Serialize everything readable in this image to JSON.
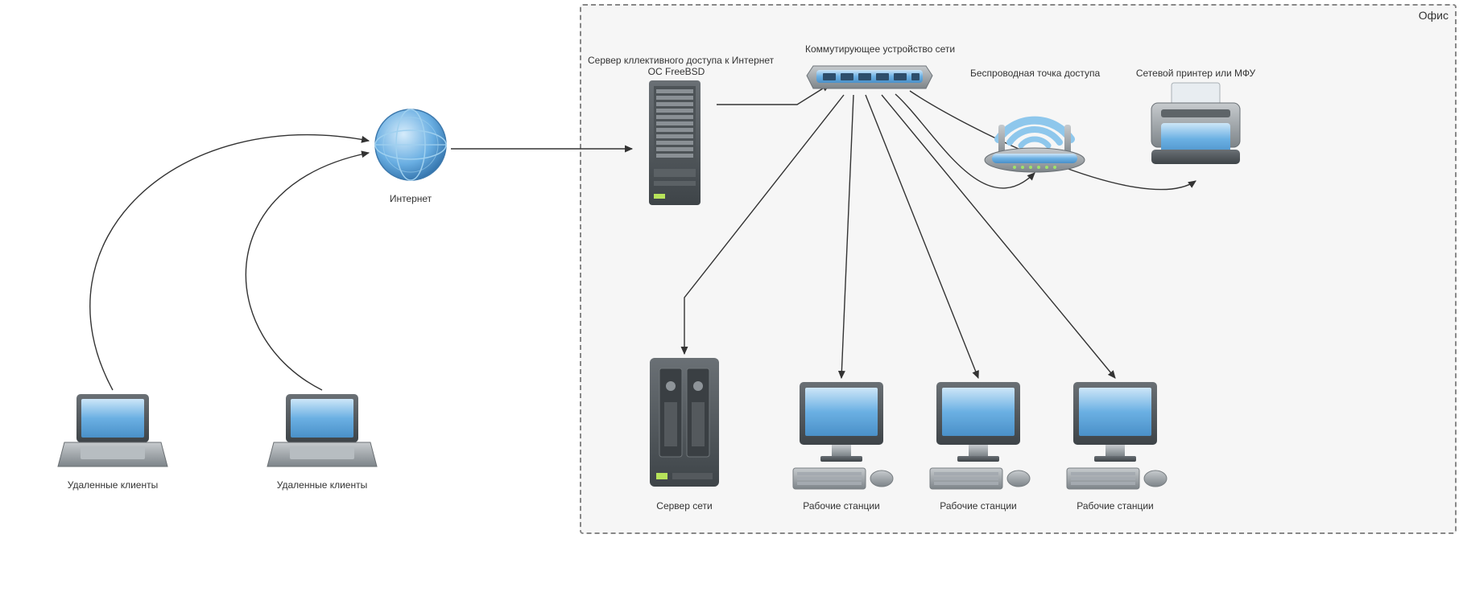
{
  "office": {
    "title": "Офис"
  },
  "internet": {
    "label": "Интернет"
  },
  "remote_clients": {
    "label": "Удаленные клиенты"
  },
  "gateway_server": {
    "line1": "Сервер кллективного доступа к Интернет",
    "line2": "ОС FreeBSD"
  },
  "switch_device": {
    "label": "Коммутирующее устройство сети"
  },
  "wireless_ap": {
    "label": "Беспроводная точка доступа"
  },
  "printer": {
    "label": "Сетевой принтер или МФУ"
  },
  "lan_server": {
    "label": "Сервер сети"
  },
  "workstation": {
    "label": "Рабочие станции"
  }
}
